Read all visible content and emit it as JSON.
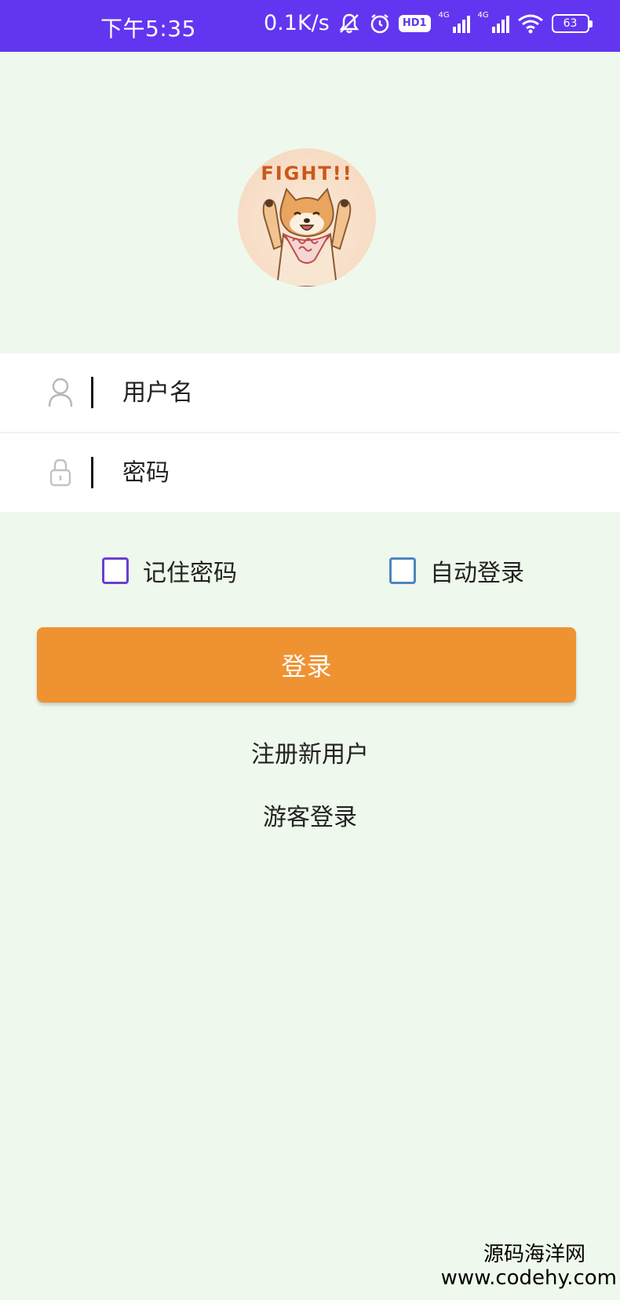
{
  "status_bar": {
    "time": "下午5:35",
    "net_speed": "0.1K/s",
    "hd_badge": "HD1",
    "signal1_type": "4G",
    "signal2_type": "4G",
    "battery": "63",
    "background_color": "#6236f0"
  },
  "avatar": {
    "caption": "FIGHT!!"
  },
  "form": {
    "username_placeholder": "用户名",
    "password_placeholder": "密码",
    "remember_label": "记住密码",
    "auto_login_label": "自动登录",
    "remember_checked": false,
    "auto_login_checked": false,
    "login_label": "登录",
    "login_color": "#ef9232"
  },
  "links": {
    "register": "注册新用户",
    "guest": "游客登录"
  },
  "watermark": {
    "line1": "源码海洋网",
    "line2": "www.codehy.com"
  },
  "icons": {
    "user": "user-icon",
    "lock": "lock-icon"
  },
  "colors": {
    "page_background": "#eff8ec",
    "checkbox_remember_border": "#6a3fd0",
    "checkbox_auto_border": "#4a86c0"
  }
}
